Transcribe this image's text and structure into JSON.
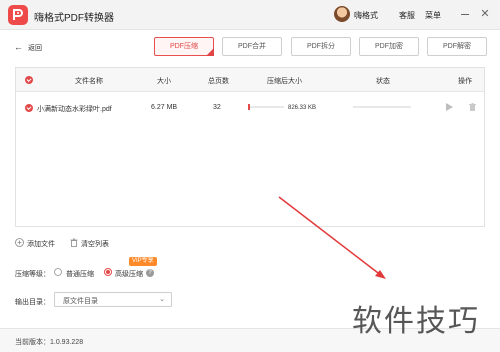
{
  "app": {
    "title": "嗨格式PDF转换器",
    "user": "嗨格式",
    "menu_service": "客服",
    "menu_main": "菜单"
  },
  "nav": {
    "back_label": "返回"
  },
  "tabs": [
    {
      "label": "PDF压缩",
      "active": true
    },
    {
      "label": "PDF合并",
      "active": false
    },
    {
      "label": "PDF拆分",
      "active": false
    },
    {
      "label": "PDF加密",
      "active": false
    },
    {
      "label": "PDF解密",
      "active": false
    }
  ],
  "table": {
    "headers": [
      "文件名称",
      "大小",
      "总页数",
      "压缩后大小",
      "状态",
      "操作"
    ],
    "rows": [
      {
        "name": "小满新动态水彩绿叶.pdf",
        "size": "6.27 MB",
        "pages": "32",
        "compressed_size": "826.33 KB",
        "progress": 0.05
      }
    ]
  },
  "actions": {
    "add_file": "添加文件",
    "clear_list": "清空列表"
  },
  "compression": {
    "label": "压缩等级：",
    "options": [
      {
        "label": "普通压缩",
        "selected": false
      },
      {
        "label": "高级压缩",
        "selected": true
      }
    ],
    "vip_badge": "VIP专享"
  },
  "output": {
    "label": "输出目录：",
    "value": "原文件目录"
  },
  "footer": {
    "version": "当前版本：1.0.93.228"
  },
  "watermark": "软件技巧",
  "colors": {
    "accent": "#e24a4a",
    "vip": "#ff8a2a"
  }
}
